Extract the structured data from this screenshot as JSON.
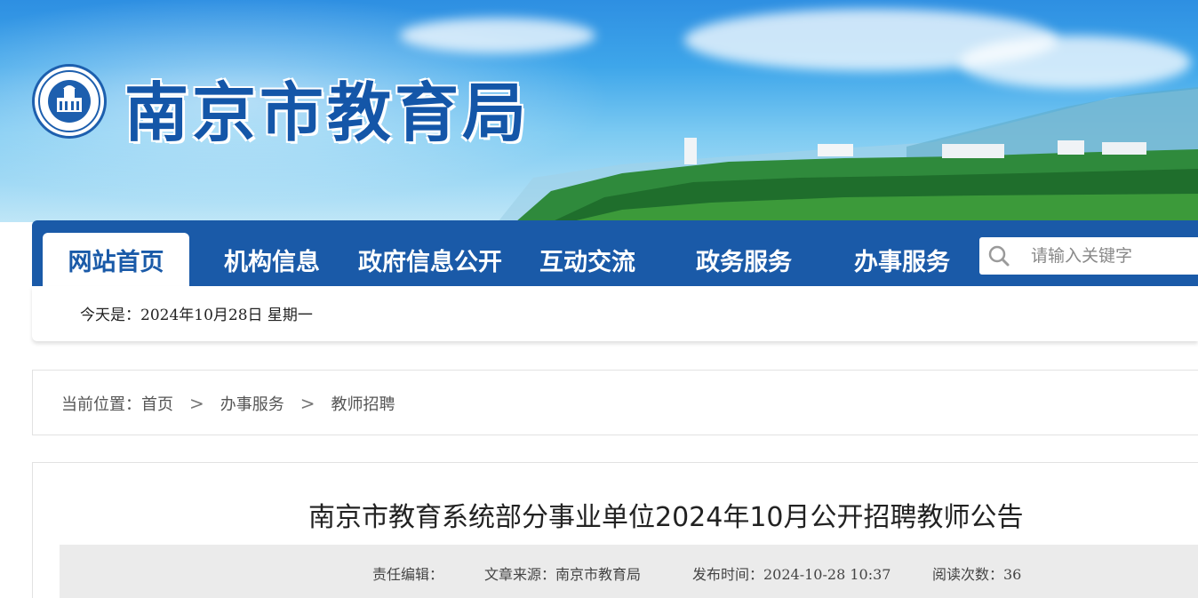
{
  "header": {
    "site_title": "南京市教育局"
  },
  "nav": {
    "items": [
      {
        "label": "网站首页",
        "active": true
      },
      {
        "label": "机构信息",
        "active": false
      },
      {
        "label": "政府信息公开",
        "active": false
      },
      {
        "label": "互动交流",
        "active": false
      },
      {
        "label": "政务服务",
        "active": false
      },
      {
        "label": "办事服务",
        "active": false
      }
    ],
    "search_placeholder": "请输入关键字",
    "search_icon": "search-icon",
    "active_color": "#1a5aa8"
  },
  "datebar": {
    "text": "今天是：2024年10月28日 星期一"
  },
  "breadcrumb": {
    "prefix": "当前位置：",
    "items": [
      "首页",
      "办事服务",
      "教师招聘"
    ],
    "separator": ">"
  },
  "article": {
    "title": "南京市教育系统部分事业单位2024年10月公开招聘教师公告",
    "editor": "责任编辑：",
    "source": "文章来源：南京市教育局",
    "published": "发布时间：2024-10-28 10:37",
    "reads": "阅读次数：36"
  }
}
